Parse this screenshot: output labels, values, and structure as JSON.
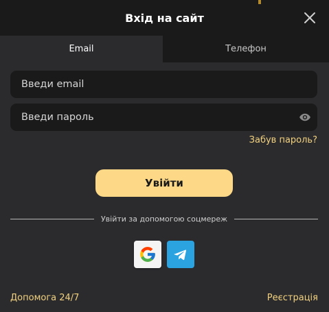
{
  "header": {
    "title": "Вхід на сайт"
  },
  "tabs": [
    {
      "label": "Email",
      "active": true
    },
    {
      "label": "Телефон",
      "active": false
    }
  ],
  "form": {
    "email_placeholder": "Введи email",
    "password_placeholder": "Введи пароль",
    "forgot_label": "Забув пароль?",
    "submit_label": "Увійти"
  },
  "social": {
    "divider_text": "Увійти за допомогою соцмереж",
    "providers": [
      "google-icon",
      "telegram-icon"
    ]
  },
  "footer": {
    "help_label": "Допомога 24/7",
    "register_label": "Реєстрація"
  },
  "colors": {
    "background": "#2b2b2e",
    "header_background": "#1a1a1a",
    "accent": "#fdd987",
    "link": "#f3d27f",
    "telegram": "#2aa3e0"
  }
}
